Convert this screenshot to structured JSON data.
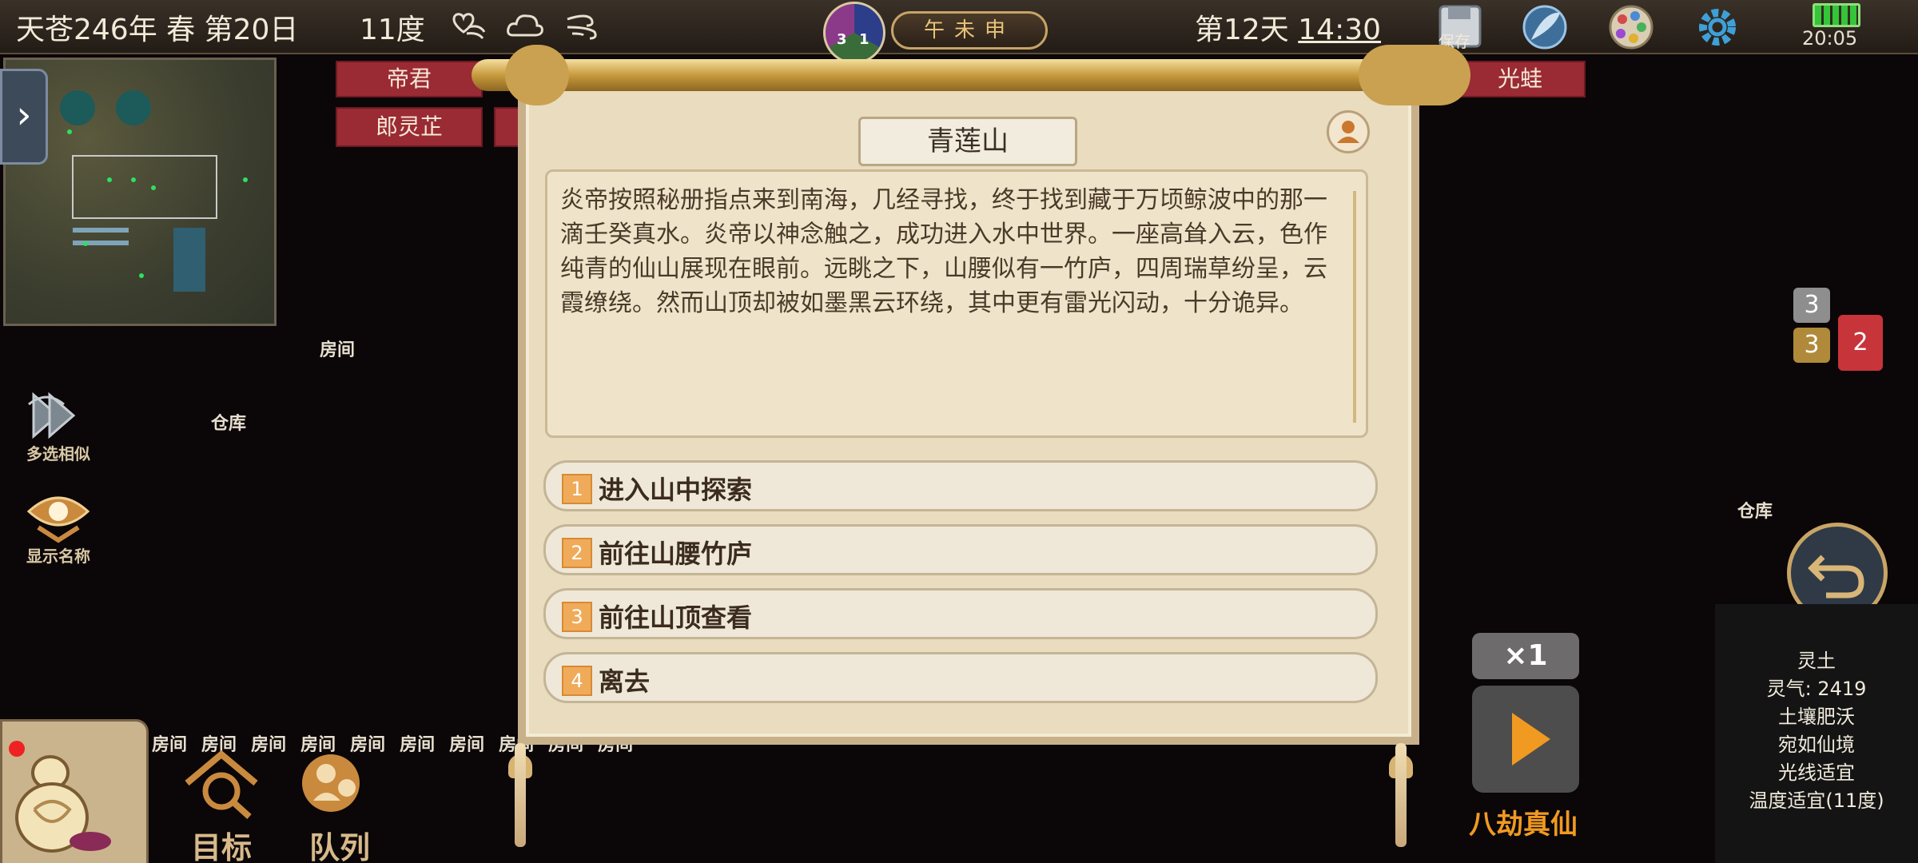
{
  "hud": {
    "date": "天苍246年 春 第20日",
    "temperature": "11度",
    "taiji_numbers": [
      "3",
      "1"
    ],
    "hours": "午未申",
    "day_label": "第12天",
    "clock": "14:30",
    "save_label": "保存",
    "system_time": "20:05"
  },
  "icons": [
    "heart-wind-icon",
    "cloud-icon",
    "wind-icon",
    "save-icon",
    "feather-icon",
    "palette-icon",
    "gear-icon",
    "battery-icon"
  ],
  "name_tags": [
    "帝君",
    "郎灵芷",
    "光蛙"
  ],
  "map_labels": {
    "room": "房间",
    "warehouse": "仓库",
    "warehouse_right": "仓库",
    "room_row": [
      "房间",
      "房间",
      "房间",
      "房间",
      "房间",
      "房间",
      "房间",
      "房间",
      "房间",
      "房间",
      "房间",
      "房间"
    ]
  },
  "tools": {
    "multi_select": "多选相似",
    "show_names": "显示名称",
    "target": "目标",
    "queue": "队列"
  },
  "dialog": {
    "title": "青莲山",
    "story": "炎帝按照秘册指点来到南海，几经寻找，终于找到藏于万顷鲸波中的那一滴壬癸真水。炎帝以神念触之，成功进入水中世界。一座高耸入云，色作纯青的仙山展现在眼前。远眺之下，山腰似有一竹庐，四周瑞草纷呈，云霞缭绕。然而山顶却被如墨黑云环绕，其中更有雷光闪动，十分诡异。",
    "choices": [
      {
        "num": "1",
        "label": "进入山中探索"
      },
      {
        "num": "2",
        "label": "前往山腰竹庐"
      },
      {
        "num": "3",
        "label": "前往山顶查看"
      },
      {
        "num": "4",
        "label": "离去"
      }
    ]
  },
  "right_panel": {
    "badges": [
      "3",
      "3",
      "2"
    ],
    "speed": "×1",
    "rank": "八劫真仙",
    "tile_info": [
      "灵土",
      "灵气: 2419",
      "土壤肥沃",
      "宛如仙境",
      "光线适宜",
      "温度适宜(11度)"
    ]
  },
  "colors": {
    "accent": "#f09a21",
    "choice_number": "#efab5a",
    "name_tag": "#9a2a34"
  }
}
